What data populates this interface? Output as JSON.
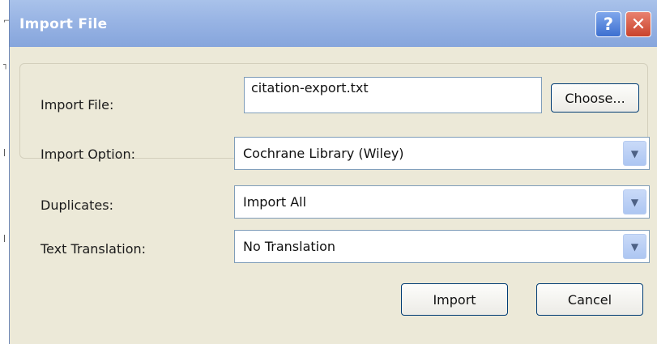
{
  "window": {
    "title": "Import File",
    "help_glyph": "?",
    "close_glyph": "✕"
  },
  "form": {
    "import_file_label": "Import File:",
    "import_file_value": "citation-export.txt",
    "choose_label": "Choose...",
    "import_option_label": "Import Option:",
    "import_option_value": "Cochrane Library (Wiley)",
    "duplicates_label": "Duplicates:",
    "duplicates_value": "Import All",
    "text_translation_label": "Text Translation:",
    "text_translation_value": "No Translation"
  },
  "buttons": {
    "import_label": "Import",
    "cancel_label": "Cancel"
  },
  "icons": {
    "dropdown": "chevron-down-icon"
  },
  "colors": {
    "titlebar": "#98b4e4",
    "dialog_bg": "#ece9d8",
    "close": "#c9432c",
    "help": "#3c6fd0"
  }
}
